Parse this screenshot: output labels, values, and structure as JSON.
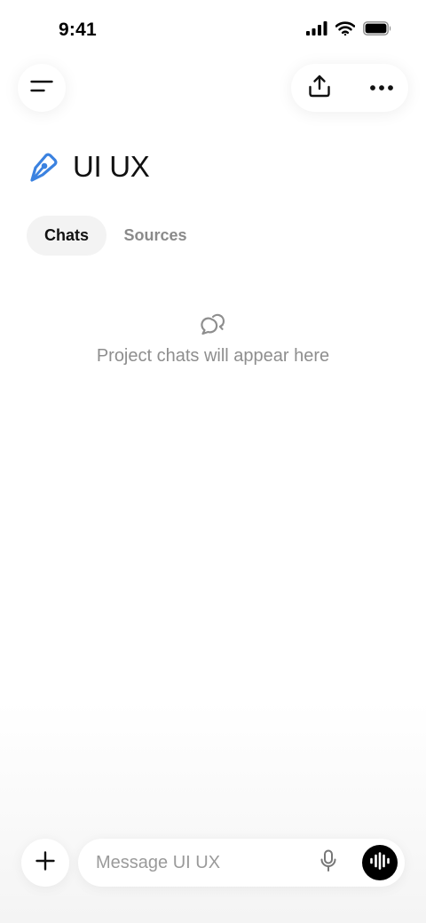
{
  "status_bar": {
    "time": "9:41",
    "icons": [
      "cellular-signal-icon",
      "wifi-icon",
      "battery-icon"
    ]
  },
  "header": {
    "menu_icon": "menu-icon",
    "share_icon": "share-icon",
    "more_icon": "more-icon"
  },
  "project": {
    "icon": "pen-nib-icon",
    "icon_color": "#3b82e0",
    "title": "UI UX"
  },
  "tabs": [
    {
      "label": "Chats",
      "active": true
    },
    {
      "label": "Sources",
      "active": false
    }
  ],
  "empty_state": {
    "icon": "chat-bubbles-icon",
    "message": "Project chats will appear here"
  },
  "composer": {
    "add_icon": "plus-icon",
    "placeholder": "Message UI UX",
    "value": "",
    "mic_icon": "microphone-icon",
    "voice_icon": "voice-waveform-icon"
  },
  "colors": {
    "accent": "#3b82e0",
    "tab_active_bg": "#f3f3f3",
    "muted_text": "#8e8e8e"
  }
}
